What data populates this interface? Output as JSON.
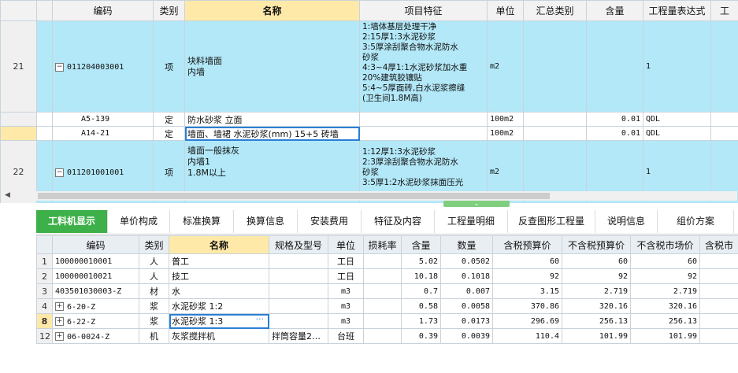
{
  "upper": {
    "headers": [
      "编码",
      "类别",
      "名称",
      "项目特征",
      "单位",
      "汇总类别",
      "含量",
      "工程量表达式",
      "工"
    ],
    "rows": [
      {
        "no": "21",
        "code": "011204003001",
        "type": "项",
        "name": "块料墙面\n内墙",
        "feature": "1:墙体基层处理干净\n2:15厚1:3水泥砂浆\n3:5厚涂刮聚合物水泥防水\n砂浆\n4:3~4厚1:1水泥砂浆加水重\n20%建筑胶镶贴\n5:4~5厚面砖,白水泥浆擦缝\n(卫生间1.8M高)",
        "unit": "m2",
        "summary": "",
        "amount": "",
        "expr": "1"
      },
      {
        "no": "",
        "code": "A5-139",
        "type": "定",
        "name": "防水砂浆 立面",
        "feature": "",
        "unit": "100m2",
        "summary": "",
        "amount": "0.01",
        "expr": "QDL"
      },
      {
        "no": "",
        "code": "A14-21",
        "type": "定",
        "name": "墙面、墙裙 水泥砂浆(mm) 15+5 砖墙",
        "feature": "",
        "unit": "100m2",
        "summary": "",
        "amount": "0.01",
        "expr": "QDL"
      },
      {
        "no": "22",
        "code": "011201001001",
        "type": "项",
        "name": "墙面一般抹灰\n内墙1\n1.8M以上",
        "feature": "1:12厚1:3水泥砂浆\n2:3厚涂刮聚合物水泥防水\n砂浆\n3:5厚1:2水泥砂浆抹面压光",
        "unit": "m2",
        "summary": "",
        "amount": "",
        "expr": "1"
      }
    ]
  },
  "tabs": [
    "工料机显示",
    "单价构成",
    "标准换算",
    "换算信息",
    "安装费用",
    "特征及内容",
    "工程量明细",
    "反查图形工程量",
    "说明信息",
    "组价方案"
  ],
  "lower": {
    "headers": [
      "",
      "编码",
      "类别",
      "名称",
      "规格及型号",
      "单位",
      "损耗率",
      "含量",
      "数量",
      "含税预算价",
      "不含税预算价",
      "不含税市场价",
      "含税市"
    ],
    "rows": [
      {
        "no": "1",
        "code": "100000010001",
        "type": "人",
        "name": "普工",
        "spec": "",
        "unit": "工日",
        "loss": "",
        "amount": "5.02",
        "qty": "0.0502",
        "p1": "60",
        "p2": "60",
        "p3": "60"
      },
      {
        "no": "2",
        "code": "100000010021",
        "type": "人",
        "name": "技工",
        "spec": "",
        "unit": "工日",
        "loss": "",
        "amount": "10.18",
        "qty": "0.1018",
        "p1": "92",
        "p2": "92",
        "p3": "92"
      },
      {
        "no": "3",
        "code": "403501030003-Z",
        "type": "材",
        "name": "水",
        "spec": "",
        "unit": "m3",
        "loss": "",
        "amount": "0.7",
        "qty": "0.007",
        "p1": "3.15",
        "p2": "2.719",
        "p3": "2.719"
      },
      {
        "no": "4",
        "code": "6-20-Z",
        "type": "浆",
        "name": "水泥砂浆 1:2",
        "spec": "",
        "unit": "m3",
        "loss": "",
        "amount": "0.58",
        "qty": "0.0058",
        "p1": "370.86",
        "p2": "320.16",
        "p3": "320.16"
      },
      {
        "no": "8",
        "code": "6-22-Z",
        "type": "浆",
        "name": "水泥砂浆 1:3",
        "spec": "",
        "unit": "m3",
        "loss": "",
        "amount": "1.73",
        "qty": "0.0173",
        "p1": "296.69",
        "p2": "256.13",
        "p3": "256.13"
      },
      {
        "no": "12",
        "code": "06-0024-Z",
        "type": "机",
        "name": "灰浆搅拌机",
        "spec": "拌筒容量2…",
        "unit": "台班",
        "loss": "",
        "amount": "0.39",
        "qty": "0.0039",
        "p1": "110.4",
        "p2": "101.99",
        "p3": "101.99"
      }
    ]
  }
}
